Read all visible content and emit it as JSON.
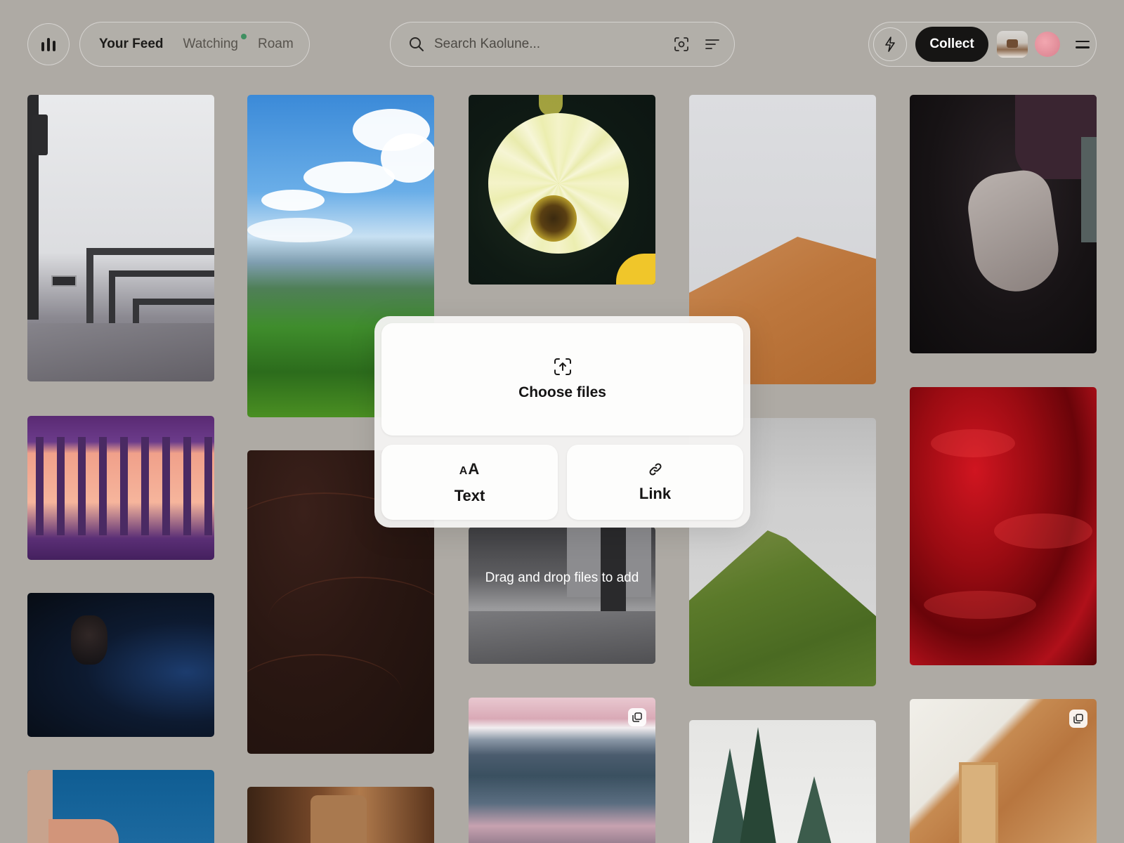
{
  "header": {
    "nav_tabs": [
      {
        "label": "Your Feed",
        "active": true
      },
      {
        "label": "Watching",
        "active": false,
        "has_dot": true
      },
      {
        "label": "Roam",
        "active": false
      }
    ],
    "search": {
      "placeholder": "Search Kaolune..."
    },
    "collect_label": "Collect"
  },
  "add_modal": {
    "choose_files_label": "Choose files",
    "text_label": "Text",
    "text_icon_small": "A",
    "text_icon_large": "A",
    "link_label": "Link"
  },
  "drop_hint": "Drag and drop files to add",
  "colors": {
    "background": "#aeaaa4",
    "collect_button": "#161514",
    "watching_dot": "#3f8f61",
    "avatar": "#e293a0"
  },
  "icons": {
    "logo": "bar-chart-icon",
    "search": "search-icon",
    "visual_search": "scan-icon",
    "filter": "sort-lines-icon",
    "activity": "lightning-bolt-icon",
    "menu": "hamburger-icon",
    "upload": "upload-scan-icon",
    "text": "font-size-icon",
    "link": "chain-link-icon",
    "multi_image": "copy-stack-icon"
  }
}
